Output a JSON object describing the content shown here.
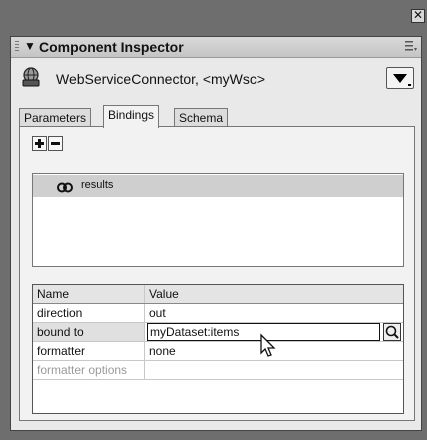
{
  "window": {
    "close_glyph": "✕"
  },
  "panel": {
    "title": "Component Inspector",
    "collapse_glyph": "▼",
    "options_icon": "panel-options-icon"
  },
  "component": {
    "icon": "web-service-icon",
    "name": "WebServiceConnector, <myWsc>"
  },
  "tabs": [
    {
      "label": "Parameters",
      "active": false
    },
    {
      "label": "Bindings",
      "active": true
    },
    {
      "label": "Schema",
      "active": false
    }
  ],
  "toolbar": {
    "add_icon": "plus-icon",
    "remove_icon": "minus-icon"
  },
  "bindings": {
    "items": [
      {
        "label": "results",
        "icon": "binding-link-icon",
        "selected": true
      }
    ]
  },
  "properties": {
    "headers": {
      "name": "Name",
      "value": "Value"
    },
    "rows": [
      {
        "name": "direction",
        "value": "out"
      },
      {
        "name": "bound to",
        "value": "myDataset:items"
      },
      {
        "name": "formatter",
        "value": "none"
      },
      {
        "name": "formatter options",
        "value": ""
      }
    ]
  },
  "colors": {
    "panel_bg": "#e9e9e9",
    "selection": "#cfcfcf",
    "frame": "#6e6e6e"
  }
}
